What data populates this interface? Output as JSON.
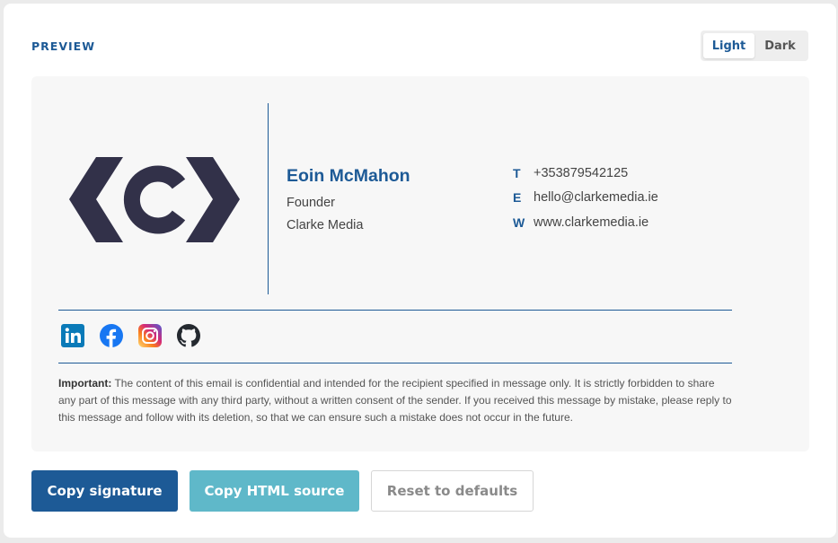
{
  "header": {
    "label": "PREVIEW",
    "theme_toggle": {
      "light": "Light",
      "dark": "Dark",
      "selected": "Light"
    }
  },
  "signature": {
    "name": "Eoin McMahon",
    "role": "Founder",
    "company": "Clarke Media",
    "contacts": [
      {
        "key": "T",
        "value": "+353879542125"
      },
      {
        "key": "E",
        "value": "hello@clarkemedia.ie"
      },
      {
        "key": "W",
        "value": "www.clarkemedia.ie"
      }
    ],
    "logo_icon": "clarke-media-logo",
    "socials": [
      "linkedin-icon",
      "facebook-icon",
      "instagram-icon",
      "github-icon"
    ],
    "disclaimer": {
      "label": "Important:",
      "text": " The content of this email is confidential and intended for the recipient specified in message only. It is strictly forbidden to share any part of this message with any third party, without a written consent of the sender. If you received this message by mistake, please reply to this message and follow with its deletion, so that we can ensure such a mistake does not occur in the future."
    }
  },
  "actions": {
    "copy_signature": "Copy signature",
    "copy_html": "Copy HTML source",
    "reset": "Reset to defaults"
  },
  "colors": {
    "accent": "#1d5a96",
    "secondary": "#5fb8c9",
    "logo": "#323149"
  }
}
